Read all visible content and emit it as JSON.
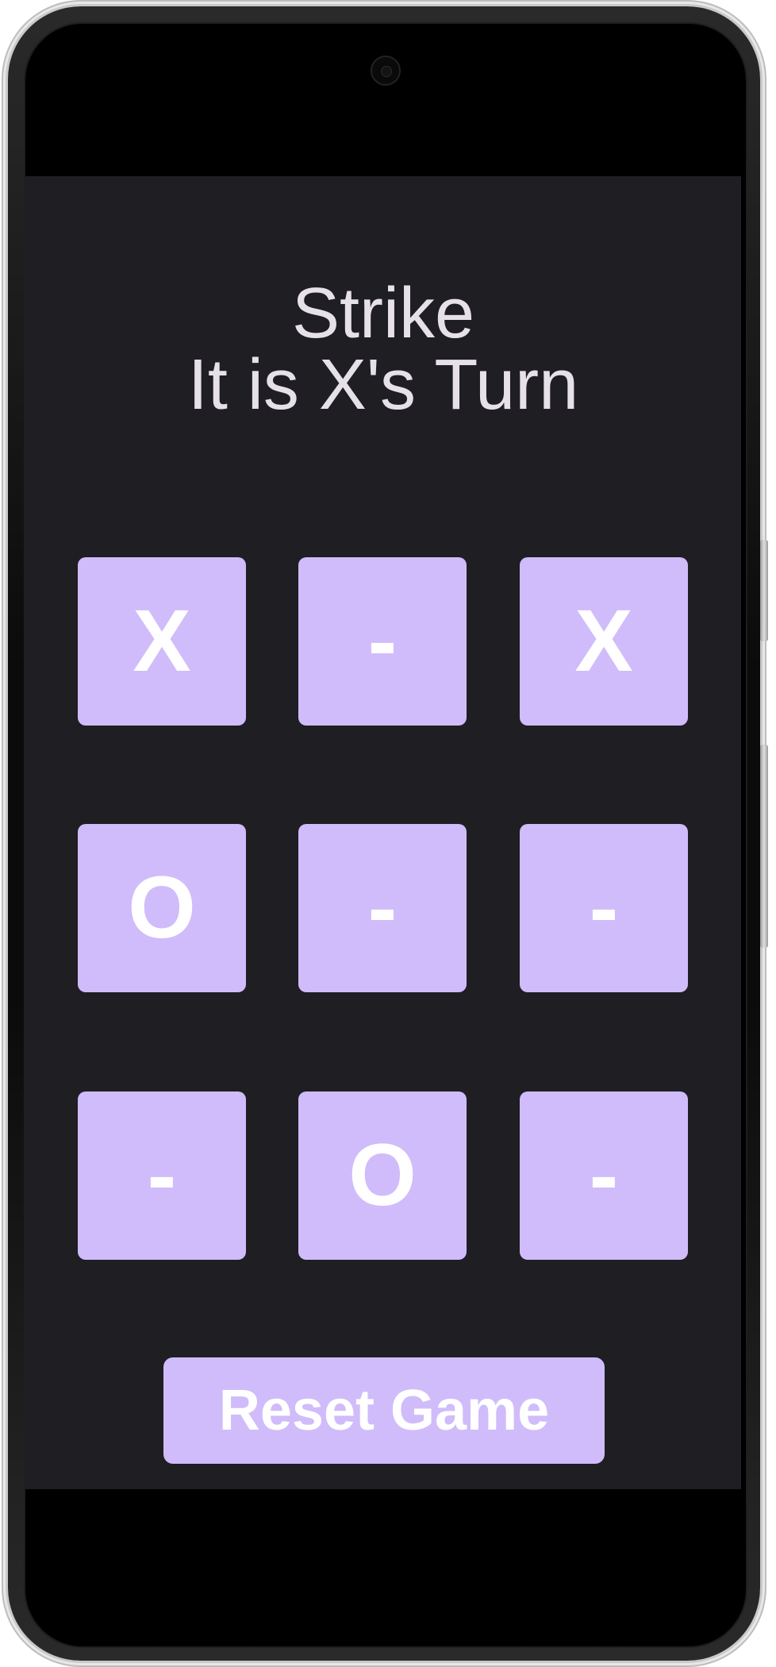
{
  "game": {
    "title": "Strike",
    "status": "It is X's Turn",
    "board": [
      [
        "X",
        "-",
        "X"
      ],
      [
        "O",
        "-",
        "-"
      ],
      [
        "-",
        "O",
        "-"
      ]
    ]
  },
  "controls": {
    "reset_label": "Reset Game"
  },
  "colors": {
    "background": "#1f1e23",
    "cell": "#d0bcfa",
    "cell_text": "#ffffff",
    "title_text": "#e6e1e9"
  }
}
